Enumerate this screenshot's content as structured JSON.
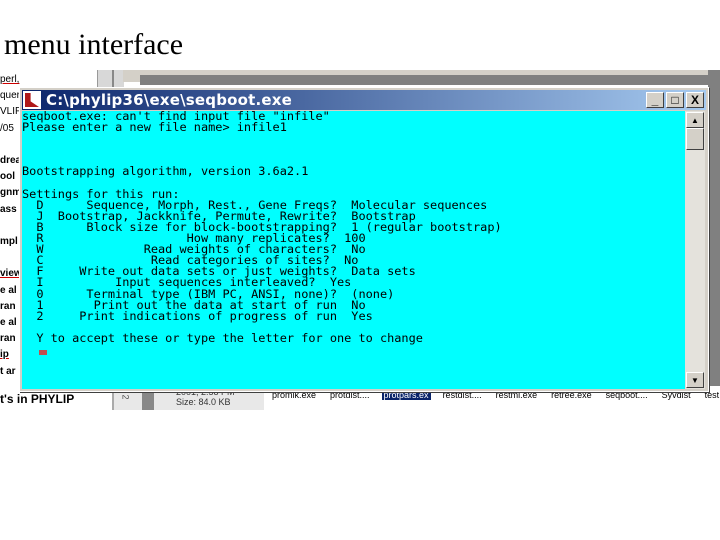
{
  "slide": {
    "title": "menu interface"
  },
  "background": {
    "left_fragments": [
      {
        "text": "perl,",
        "bold": false,
        "underline": true
      },
      {
        "text": "quer",
        "bold": false,
        "underline": false
      },
      {
        "text": "VLIF",
        "bold": false,
        "underline": false
      },
      {
        "text": "/05",
        "bold": false,
        "underline": false
      },
      {
        "text": "",
        "bold": false,
        "underline": false
      },
      {
        "text": "drea",
        "bold": true,
        "underline": false
      },
      {
        "text": "ool",
        "bold": true,
        "underline": false
      },
      {
        "text": "gnm",
        "bold": true,
        "underline": false
      },
      {
        "text": "ass",
        "bold": true,
        "underline": false
      },
      {
        "text": "",
        "bold": false,
        "underline": false
      },
      {
        "text": "mpl",
        "bold": true,
        "underline": false
      },
      {
        "text": "",
        "bold": false,
        "underline": false
      },
      {
        "text": "view",
        "bold": true,
        "underline": true
      },
      {
        "text": "e al",
        "bold": true,
        "underline": false
      },
      {
        "text": "ran",
        "bold": true,
        "underline": false
      },
      {
        "text": "e al",
        "bold": true,
        "underline": false
      },
      {
        "text": "ran",
        "bold": true,
        "underline": false
      },
      {
        "text": "ip",
        "bold": true,
        "underline": true
      },
      {
        "text": "t ar",
        "bold": true,
        "underline": false
      }
    ],
    "bottom_heading": "t's in PHYLIP",
    "file_info_date": "2001, 2:58 PM",
    "file_info_size": "Size: 84.0 KB",
    "panel_number": "2",
    "files": [
      {
        "name": "promlk.exe",
        "selected": false
      },
      {
        "name": "protdist....",
        "selected": false
      },
      {
        "name": "protpars.ex",
        "selected": true
      },
      {
        "name": "restdist....",
        "selected": false
      },
      {
        "name": "restml.exe",
        "selected": false
      },
      {
        "name": "retree.exe",
        "selected": false
      },
      {
        "name": "seqboot....",
        "selected": false
      },
      {
        "name": "Syvdist",
        "selected": false
      },
      {
        "name": "test",
        "selected": false
      }
    ]
  },
  "console": {
    "title": "C:\\phylip36\\exe\\seqboot.exe",
    "buttons": {
      "minimize": "_",
      "maximize": "□",
      "close": "X"
    },
    "scroll": {
      "up": "▲",
      "down": "▼"
    },
    "colors": {
      "screen_bg": "#00ffff",
      "title_start": "#0a246a",
      "title_end": "#a6caf0"
    },
    "lines": [
      "seqboot.exe: can't find input file \"infile\"",
      "Please enter a new file name> infile1",
      "",
      "",
      "",
      "Bootstrapping algorithm, version 3.6a2.1",
      "",
      "Settings for this run:",
      "  D      Sequence, Morph, Rest., Gene Freqs?  Molecular sequences",
      "  J  Bootstrap, Jackknife, Permute, Rewrite?  Bootstrap",
      "  B      Block size for block-bootstrapping?  1 (regular bootstrap)",
      "  R                    How many replicates?  100",
      "  W              Read weights of characters?  No",
      "  C               Read categories of sites?  No",
      "  F     Write out data sets or just weights?  Data sets",
      "  I          Input sequences interleaved?  Yes",
      "  0      Terminal type (IBM PC, ANSI, none)?  (none)",
      "  1       Print out the data at start of run  No",
      "  2     Print indications of progress of run  Yes",
      "",
      "  Y to accept these or type the letter for one to change"
    ]
  }
}
